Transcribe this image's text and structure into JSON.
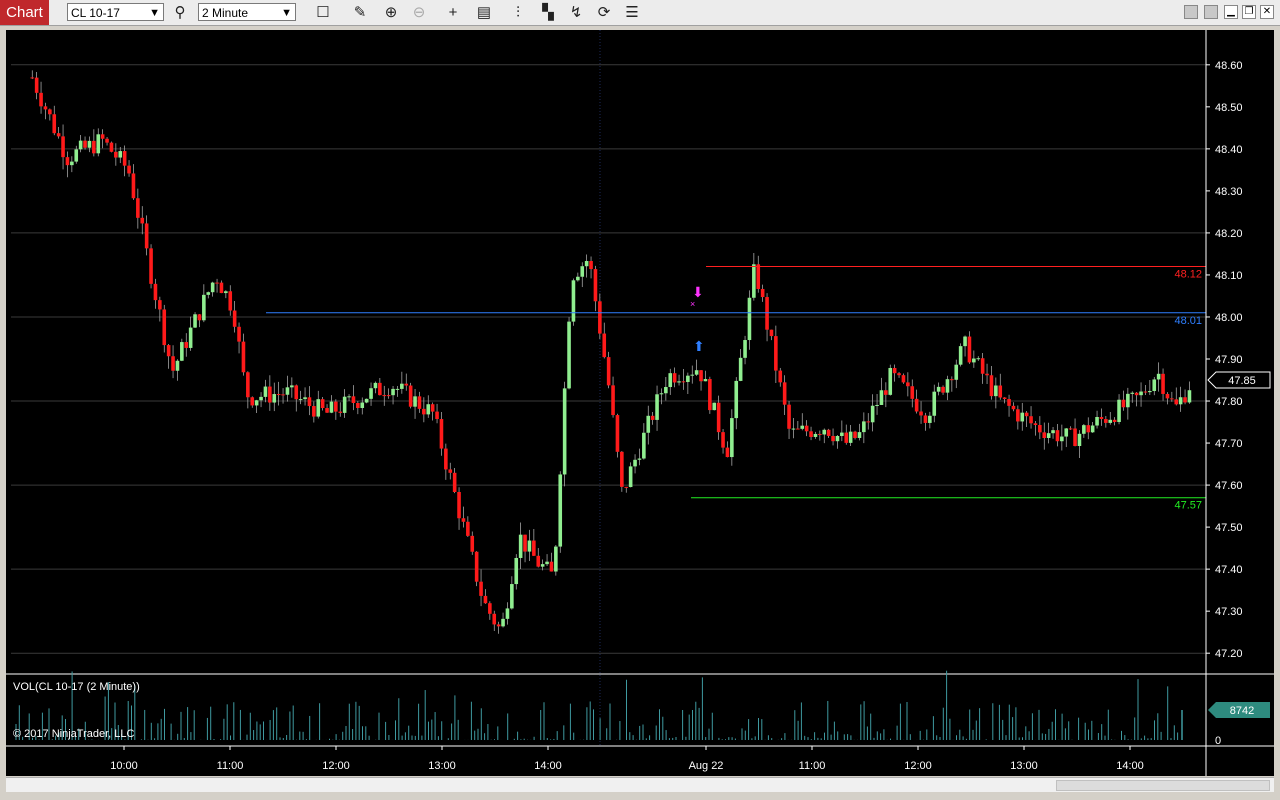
{
  "toolbar": {
    "tab_label": "Chart",
    "instrument": "CL 10-17",
    "interval": "2 Minute",
    "icons": [
      "search-icon",
      "box-icon",
      "pencil-icon",
      "zoom-in-icon",
      "zoom-out-icon",
      "crosshair-icon",
      "properties-icon",
      "bar-type-icon",
      "strategy-icon",
      "indicator-icon",
      "refresh-icon",
      "list-icon"
    ]
  },
  "price_panel": {
    "y_ticks": [
      "48.60",
      "48.50",
      "48.40",
      "48.30",
      "48.20",
      "48.10",
      "48.00",
      "47.90",
      "47.80",
      "47.70",
      "47.60",
      "47.50",
      "47.40",
      "47.30",
      "47.20"
    ],
    "current_price": "47.85",
    "lines": [
      {
        "label": "48.12",
        "value": 48.12,
        "color": "#ff2020"
      },
      {
        "label": "48.01",
        "value": 48.01,
        "color": "#2f7fff"
      },
      {
        "label": "47.57",
        "value": 47.57,
        "color": "#22ee22"
      }
    ]
  },
  "volume_panel": {
    "label": "VOL(CL 10-17 (2 Minute))",
    "last_volume": "8742",
    "zero_label": "0",
    "copyright": "© 2017 NinjaTrader, LLC"
  },
  "time_axis": [
    "10:00",
    "11:00",
    "12:00",
    "13:00",
    "14:00",
    "Aug 22",
    "11:00",
    "12:00",
    "13:00",
    "14:00"
  ],
  "colors": {
    "up": "#90ee90",
    "down": "#ff1a1a",
    "background": "#000000",
    "volume": "#3f9aa0",
    "current_price_box": "#000000",
    "volume_box": "#2e8b7f"
  },
  "chart_data": {
    "type": "candlestick",
    "title": "",
    "x": [
      "09:16",
      "09:38",
      "09:58",
      "10:14",
      "10:42",
      "11:16",
      "11:26",
      "11:34",
      "11:36",
      "11:56",
      "12:20",
      "12:56",
      "13:20",
      "13:50",
      "14:00",
      "14:10",
      "14:20",
      "14:30",
      "14:40",
      "14:50",
      "09:00",
      "09:08",
      "09:34",
      "09:52",
      "10:04",
      "10:20",
      "10:40",
      "11:00",
      "11:12",
      "11:20",
      "11:38",
      "11:58",
      "12:20",
      "12:40",
      "13:00",
      "13:20",
      "13:40",
      "14:00",
      "14:10",
      "14:20",
      "14:30"
    ],
    "series": [
      {
        "name": "CL 10-17",
        "close": [
          48.57,
          48.38,
          48.42,
          48.35,
          47.87,
          48.1,
          48.02,
          47.82,
          47.81,
          47.82,
          47.77,
          47.84,
          47.77,
          47.32,
          47.25,
          47.48,
          47.42,
          47.38,
          48.1,
          48.14,
          47.85,
          47.58,
          47.86,
          47.88,
          47.68,
          48.12,
          47.72,
          47.74,
          47.7,
          47.72,
          47.86,
          47.77,
          47.93,
          47.8,
          47.74,
          47.71,
          47.76,
          47.81,
          47.87,
          47.78,
          47.85
        ]
      }
    ],
    "volume": [
      8742
    ],
    "ylim": [
      47.16,
      48.64
    ]
  }
}
